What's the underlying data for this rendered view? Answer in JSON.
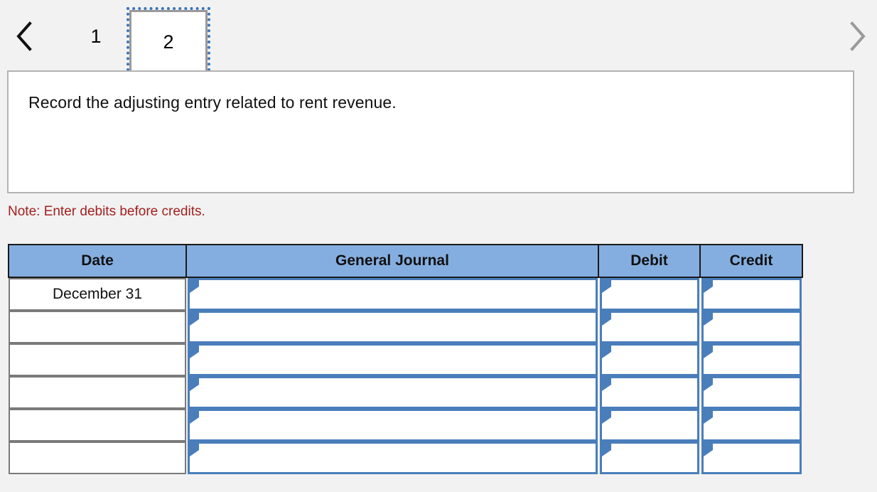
{
  "pager": {
    "prev_icon": "chevron-left-icon",
    "next_icon": "chevron-right-icon",
    "tabs": [
      {
        "label": "1",
        "active": false
      },
      {
        "label": "2",
        "active": true
      }
    ]
  },
  "instruction": {
    "text": "Record the adjusting entry related to rent revenue."
  },
  "note": {
    "text": "Note: Enter debits before credits."
  },
  "journal": {
    "headers": {
      "date": "Date",
      "general_journal": "General Journal",
      "debit": "Debit",
      "credit": "Credit"
    },
    "rows": [
      {
        "date": "December 31",
        "account": "",
        "debit": "",
        "credit": ""
      },
      {
        "date": "",
        "account": "",
        "debit": "",
        "credit": ""
      },
      {
        "date": "",
        "account": "",
        "debit": "",
        "credit": ""
      },
      {
        "date": "",
        "account": "",
        "debit": "",
        "credit": ""
      },
      {
        "date": "",
        "account": "",
        "debit": "",
        "credit": ""
      },
      {
        "date": "",
        "account": "",
        "debit": "",
        "credit": ""
      }
    ]
  },
  "colors": {
    "header_blue": "#85aee0",
    "input_border_blue": "#4a7ebb",
    "note_red": "#a32020",
    "page_background": "#f2f2f2",
    "focus_outline_blue": "#3d74b8"
  }
}
